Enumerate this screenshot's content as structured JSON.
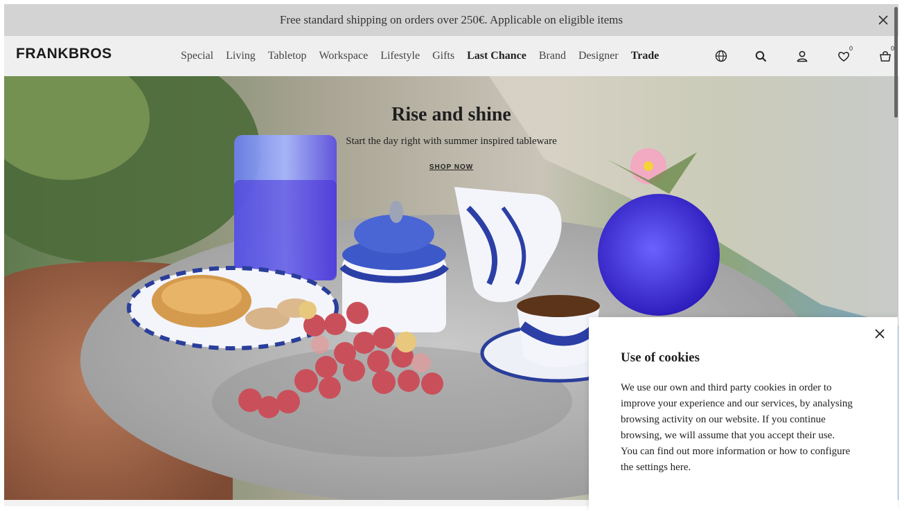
{
  "announcement": {
    "text": "Free standard shipping on orders over 250€. Applicable on eligible items"
  },
  "header": {
    "logo": "FRANKBROS",
    "nav": [
      {
        "label": "Special",
        "bold": false
      },
      {
        "label": "Living",
        "bold": false
      },
      {
        "label": "Tabletop",
        "bold": false
      },
      {
        "label": "Workspace",
        "bold": false
      },
      {
        "label": "Lifestyle",
        "bold": false
      },
      {
        "label": "Gifts",
        "bold": false
      },
      {
        "label": "Last Chance",
        "bold": true
      },
      {
        "label": "Brand",
        "bold": false
      },
      {
        "label": "Designer",
        "bold": false
      },
      {
        "label": "Trade",
        "bold": true
      }
    ],
    "icons": {
      "language": "globe-icon",
      "search": "search-icon",
      "account": "user-icon",
      "wishlist": "heart-icon",
      "cart": "bag-icon"
    },
    "wishlist_count": "0",
    "cart_count": "0"
  },
  "hero": {
    "title": "Rise and shine",
    "subtitle": "Start the day right with summer inspired tableware",
    "cta": "SHOP NOW"
  },
  "cookie": {
    "title": "Use of cookies",
    "paragraph1": "We use our own and third party cookies in order to improve your experience and our services, by analysing browsing activity on our website. If you continue browsing, we will assume that you accept their use.",
    "paragraph2": "You can find out more information or how to configure the settings here."
  },
  "colors": {
    "announcement_bg": "#d3d3d3",
    "header_bg": "#efefef",
    "cobalt": "#3a3fd4",
    "table_stone": "#b9b9b9"
  }
}
